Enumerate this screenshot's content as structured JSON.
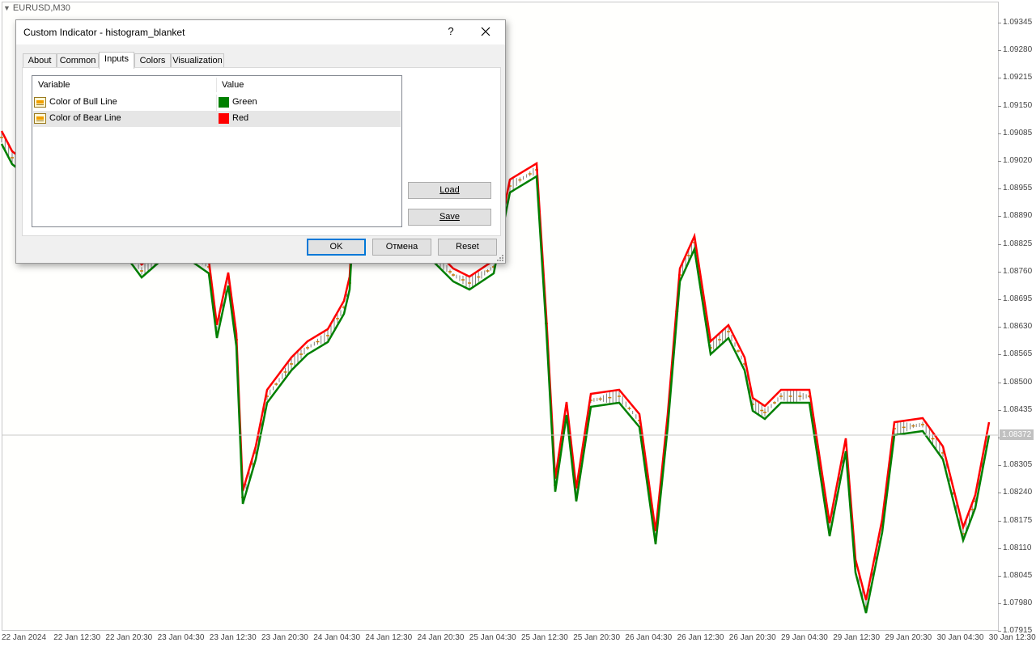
{
  "chart": {
    "symbol_title": "EURUSD,M30",
    "current_price": "1.08372",
    "colors": {
      "bull": "#008000",
      "bear": "#ff0000",
      "histogram": "#808080",
      "dash": "#cc7a00"
    },
    "price_axis": [
      "1.09345",
      "1.09280",
      "1.09215",
      "1.09150",
      "1.09085",
      "1.09020",
      "1.08955",
      "1.08890",
      "1.08825",
      "1.08760",
      "1.08695",
      "1.08630",
      "1.08565",
      "1.08500",
      "1.08435",
      "1.08370",
      "1.08305",
      "1.08240",
      "1.08175",
      "1.08110",
      "1.08045",
      "1.07980",
      "1.07915"
    ],
    "time_axis": [
      "22 Jan 2024",
      "22 Jan 12:30",
      "22 Jan 20:30",
      "23 Jan 04:30",
      "23 Jan 12:30",
      "23 Jan 20:30",
      "24 Jan 04:30",
      "24 Jan 12:30",
      "24 Jan 20:30",
      "25 Jan 04:30",
      "25 Jan 12:30",
      "25 Jan 20:30",
      "26 Jan 04:30",
      "26 Jan 12:30",
      "26 Jan 20:30",
      "29 Jan 04:30",
      "29 Jan 12:30",
      "29 Jan 20:30",
      "30 Jan 04:30",
      "30 Jan 12:30"
    ]
  },
  "dialog": {
    "title": "Custom Indicator - histogram_blanket",
    "help_label": "?",
    "tabs": [
      "About",
      "Common",
      "Inputs",
      "Colors",
      "Visualization"
    ],
    "active_tab": "Inputs",
    "grid": {
      "col_variable": "Variable",
      "col_value": "Value",
      "rows": [
        {
          "name": "Color of Bull Line",
          "value": "Green",
          "color": "#008000"
        },
        {
          "name": "Color of Bear Line",
          "value": "Red",
          "color": "#ff0000"
        }
      ]
    },
    "buttons": {
      "load": "Load",
      "save": "Save",
      "ok": "OK",
      "cancel": "Отмена",
      "reset": "Reset"
    }
  }
}
